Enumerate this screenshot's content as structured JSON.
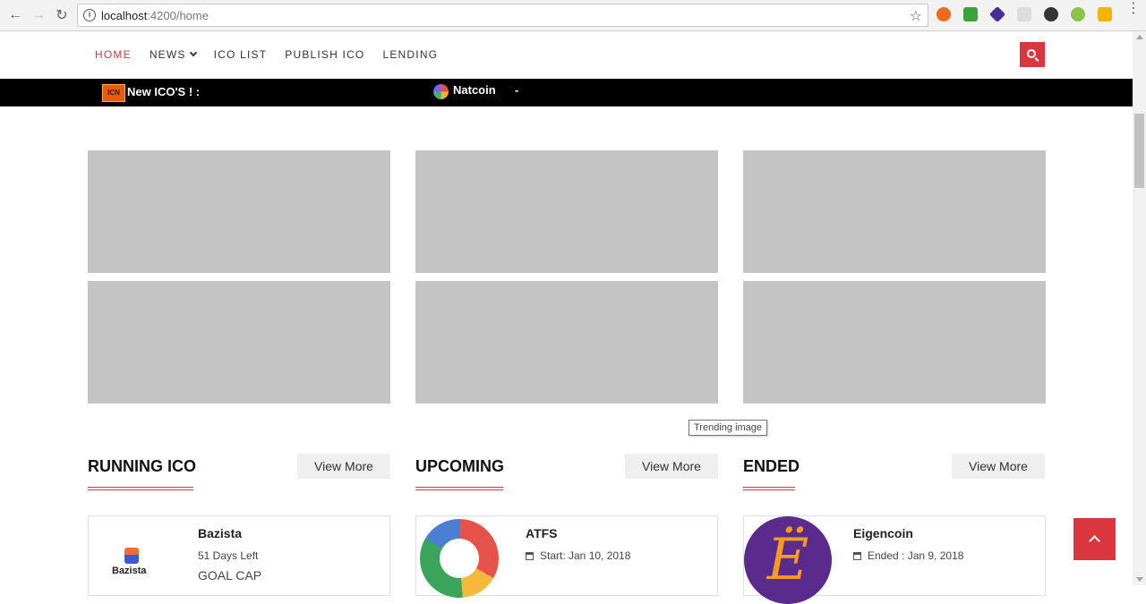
{
  "browser": {
    "url_host": "localhost",
    "url_path": ":4200/home",
    "back_icon": "arrow-left-icon",
    "forward_icon": "arrow-right-icon",
    "reload_icon": "reload-icon"
  },
  "nav": {
    "items": [
      {
        "label": "HOME"
      },
      {
        "label": "NEWS"
      },
      {
        "label": "ICO LIST"
      },
      {
        "label": "PUBLISH ICO"
      },
      {
        "label": "LENDING"
      }
    ]
  },
  "ticker": {
    "logo_text": "ICN",
    "label": "New ICO'S ! :",
    "coin": "Natcoin",
    "separator": "-"
  },
  "tooltip": "Trending image",
  "sections": [
    {
      "title": "RUNNING ICO",
      "button": "View More"
    },
    {
      "title": "UPCOMING",
      "button": "View More"
    },
    {
      "title": "ENDED",
      "button": "View More"
    }
  ],
  "cards": [
    {
      "name": "Bazista",
      "meta": "51 Days Left",
      "goal": "GOAL CAP",
      "logo_text": "Bazista"
    },
    {
      "name": "ATFS",
      "meta": "Start: Jan 10, 2018"
    },
    {
      "name": "Eigencoin",
      "meta": "Ended : Jan 9, 2018",
      "logo_text": "Ë"
    }
  ],
  "colors": {
    "accent": "#d9363e",
    "placeholder": "#c4c4c4",
    "ticker_bg": "#000000"
  }
}
